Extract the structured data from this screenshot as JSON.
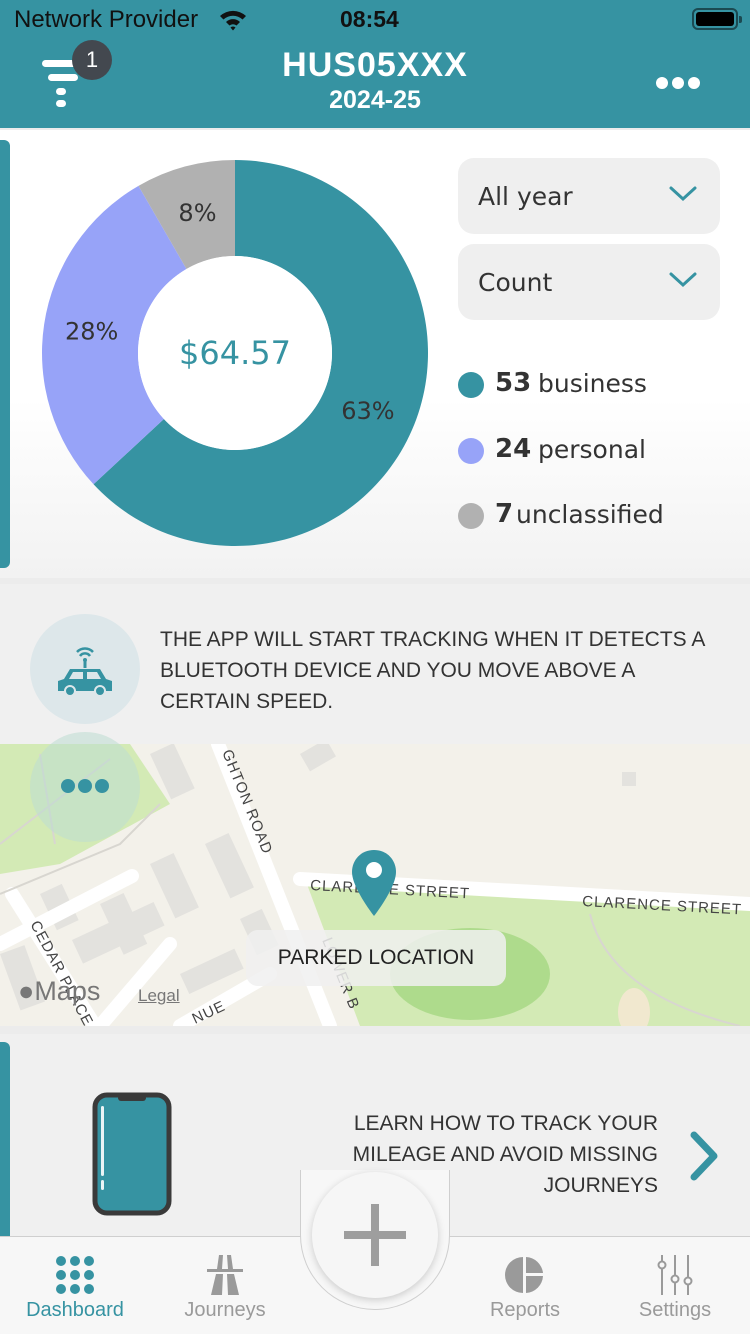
{
  "status_bar": {
    "carrier": "Network Provider",
    "time": "08:54"
  },
  "header": {
    "title": "HUS05XXX",
    "subtitle": "2024-25",
    "notification_count": "1"
  },
  "stats": {
    "total_amount": "$64.57",
    "period_select": "All year",
    "metric_select": "Count",
    "legend": [
      {
        "count": "53",
        "label": "business",
        "color": "#3693a2"
      },
      {
        "count": "24",
        "label": "personal",
        "color": "#97a3f8"
      },
      {
        "count": "7",
        "label": "unclassified",
        "color": "#b1b1b1"
      }
    ]
  },
  "chart_data": {
    "type": "pie",
    "variant": "donut",
    "center_label": "$64.57",
    "categories": [
      "business",
      "personal",
      "unclassified"
    ],
    "values": [
      53,
      24,
      7
    ],
    "percent_labels": [
      "63%",
      "28%",
      "8%"
    ],
    "colors": [
      "#3693a2",
      "#97a3f8",
      "#b1b1b1"
    ],
    "legend": "right"
  },
  "tracking": {
    "message": "THE APP WILL START TRACKING WHEN IT DETECTS A BLUETOOTH DEVICE AND YOU MOVE ABOVE A CERTAIN SPEED.",
    "map": {
      "parked_label": "PARKED LOCATION",
      "maps_brand": "Maps",
      "legal_link": "Legal",
      "street_labels": [
        "CLARENCE STREET",
        "CLARENCE STREET",
        "GHTON ROAD",
        "CEDAR PLACE",
        "LOWER B",
        "NUE"
      ]
    }
  },
  "learn": {
    "text": "LEARN HOW TO TRACK YOUR MILEAGE AND AVOID MISSING JOURNEYS"
  },
  "tabbar": {
    "tabs": [
      {
        "label": "Dashboard",
        "active": true
      },
      {
        "label": "Journeys",
        "active": false
      },
      {
        "label": "Reports",
        "active": false
      },
      {
        "label": "Settings",
        "active": false
      }
    ],
    "accent": "#3693a2"
  }
}
